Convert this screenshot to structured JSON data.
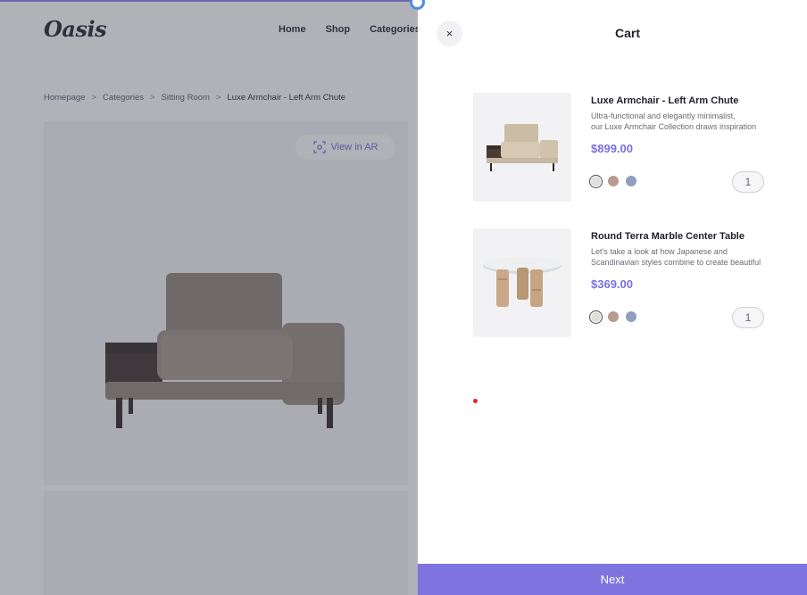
{
  "colors": {
    "accent": "#7f73df",
    "price": "#7a6fe0",
    "overlay": "rgba(70,72,85,0.42)",
    "top_accent": "#8a7de8"
  },
  "site": {
    "logo": "Oasis",
    "nav": [
      "Home",
      "Shop",
      "Categories"
    ],
    "breadcrumb": [
      "Homepage",
      "Categories",
      "Sitting Room",
      "Luxe Armchair - Left Arm Chute"
    ],
    "ar_button": "View in AR",
    "ar_icon": "ar-view-icon"
  },
  "cart": {
    "title": "Cart",
    "close_icon": "close-icon",
    "close_label": "×",
    "next_label": "Next",
    "items": [
      {
        "name": "Luxe Armchair - Left Arm Chute",
        "desc_line1": "Ultra-functional and elegantly minimalist,",
        "desc_line2": "our Luxe Armchair Collection draws inspiration",
        "price": "$899.00",
        "swatches": [
          "#e2dfda",
          "#b89a8e",
          "#8fa0bd"
        ],
        "selected_swatch": 0,
        "quantity": "1"
      },
      {
        "name": "Round Terra Marble Center Table",
        "desc_line1": "Let's take a look at how Japanese and",
        "desc_line2": "Scandinavian styles combine to create beautiful",
        "price": "$369.00",
        "swatches": [
          "#e2dfda",
          "#b89a8e",
          "#8fa0bd"
        ],
        "selected_swatch": 0,
        "quantity": "1"
      }
    ]
  }
}
